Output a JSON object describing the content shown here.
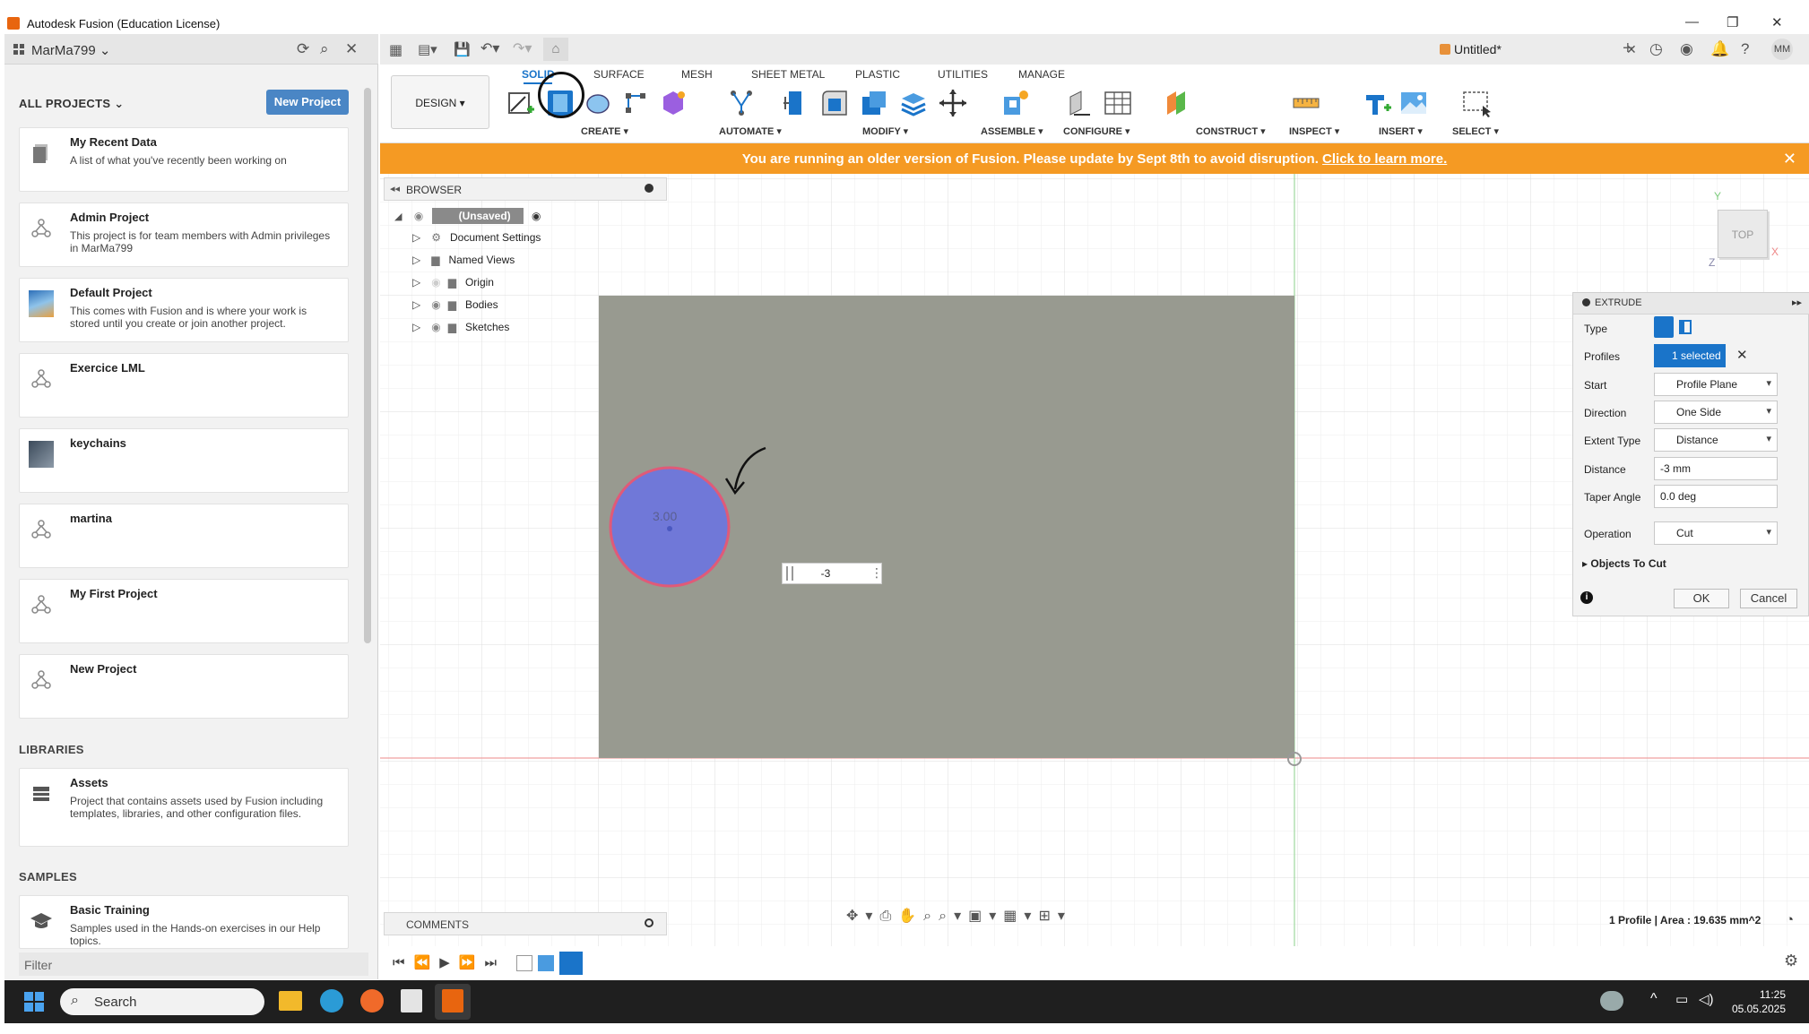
{
  "window": {
    "title": "Autodesk Fusion (Education License)"
  },
  "data_panel": {
    "user": "MarMa799",
    "all_projects_label": "ALL PROJECTS",
    "new_project_label": "New Project",
    "projects": [
      {
        "name": "My Recent Data",
        "desc": "A list of what you've recently been working on"
      },
      {
        "name": "Admin Project",
        "desc": "This project is for team members with Admin privileges in MarMa799"
      },
      {
        "name": "Default Project",
        "desc": "This comes with Fusion and is where your work is stored until you create or join another project."
      },
      {
        "name": "Exercice LML",
        "desc": ""
      },
      {
        "name": "keychains",
        "desc": ""
      },
      {
        "name": "martina",
        "desc": ""
      },
      {
        "name": "My First Project",
        "desc": ""
      },
      {
        "name": "New Project",
        "desc": ""
      }
    ],
    "libraries_label": "LIBRARIES",
    "libraries": [
      {
        "name": "Assets",
        "desc": "Project that contains assets used by Fusion including templates, libraries, and other configuration files."
      }
    ],
    "samples_label": "SAMPLES",
    "samples": [
      {
        "name": "Basic Training",
        "desc": "Samples used in the Hands-on exercises in our Help topics."
      }
    ],
    "filter_placeholder": "Filter"
  },
  "document": {
    "name": "Untitled*",
    "user_initials": "MM"
  },
  "toolbar": {
    "workspace": "DESIGN",
    "tabs": [
      "SOLID",
      "SURFACE",
      "MESH",
      "SHEET METAL",
      "PLASTIC",
      "UTILITIES",
      "MANAGE"
    ],
    "active_tab": "SOLID",
    "groups": [
      "CREATE",
      "AUTOMATE",
      "MODIFY",
      "ASSEMBLE",
      "CONFIGURE",
      "CONSTRUCT",
      "INSPECT",
      "INSERT",
      "SELECT"
    ]
  },
  "banner": {
    "message": "You are running an older version of Fusion. Please update by Sept 8th to avoid disruption.",
    "link": "Click to learn more."
  },
  "browser": {
    "title": "BROWSER",
    "root": "(Unsaved)",
    "items": [
      "Document Settings",
      "Named Views",
      "Origin",
      "Bodies",
      "Sketches"
    ]
  },
  "viewport": {
    "circle_dimension": "3.00",
    "distance_input": "-3",
    "viewcube_label": "TOP",
    "axis_y": "Y",
    "axis_x": "X",
    "axis_z": "Z"
  },
  "extrude": {
    "title": "EXTRUDE",
    "rows": {
      "type_label": "Type",
      "profiles_label": "Profiles",
      "profiles_value": "1 selected",
      "start_label": "Start",
      "start_value": "Profile Plane",
      "direction_label": "Direction",
      "direction_value": "One Side",
      "extent_label": "Extent Type",
      "extent_value": "Distance",
      "distance_label": "Distance",
      "distance_value": "-3 mm",
      "taper_label": "Taper Angle",
      "taper_value": "0.0 deg",
      "operation_label": "Operation",
      "operation_value": "Cut",
      "objects_to_cut": "Objects To Cut"
    },
    "ok_label": "OK",
    "cancel_label": "Cancel"
  },
  "comments_label": "COMMENTS",
  "status_text": "1 Profile | Area : 19.635 mm^2",
  "taskbar": {
    "search_placeholder": "Search",
    "time": "11:25",
    "date": "05.05.2025"
  },
  "colors": {
    "accent": "#1a74c9",
    "banner": "#f59a23",
    "plate": "#989a90",
    "profile_fill": "#7078d8",
    "profile_stroke": "#e05a78"
  }
}
